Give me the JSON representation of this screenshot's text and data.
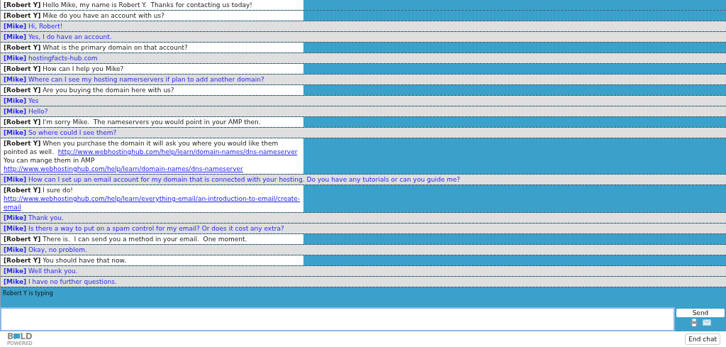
{
  "messages": [
    {
      "kind": "operator",
      "sender": "[Robert Y]",
      "segments": [
        {
          "kind": "text",
          "text": "Hello Mike, my name is Robert Y.  Thanks for contacting us today!"
        }
      ]
    },
    {
      "kind": "operator",
      "sender": "[Robert Y]",
      "segments": [
        {
          "kind": "text",
          "text": "Mike do you have an account with us?"
        }
      ]
    },
    {
      "kind": "visitor",
      "sender": "[Mike]",
      "segments": [
        {
          "kind": "text",
          "text": "Hi, Robert!"
        }
      ]
    },
    {
      "kind": "visitor",
      "sender": "[Mike]",
      "segments": [
        {
          "kind": "text",
          "text": "Yes, I do have an account."
        }
      ]
    },
    {
      "kind": "operator",
      "sender": "[Robert Y]",
      "segments": [
        {
          "kind": "text",
          "text": "What is the primary domain on that account?"
        }
      ]
    },
    {
      "kind": "visitor",
      "sender": "[Mike]",
      "segments": [
        {
          "kind": "text",
          "text": "hostingfacts-hub.com"
        }
      ]
    },
    {
      "kind": "operator",
      "sender": "[Robert Y]",
      "segments": [
        {
          "kind": "text",
          "text": "How can I help you Mike?"
        }
      ]
    },
    {
      "kind": "visitor",
      "sender": "[Mike]",
      "segments": [
        {
          "kind": "text",
          "text": "Where can I see my hosting namerservers if plan to add another domain?"
        }
      ]
    },
    {
      "kind": "operator",
      "sender": "[Robert Y]",
      "segments": [
        {
          "kind": "text",
          "text": "Are you buying the domain here with us?"
        }
      ]
    },
    {
      "kind": "visitor",
      "sender": "[Mike]",
      "segments": [
        {
          "kind": "text",
          "text": "Yes"
        }
      ]
    },
    {
      "kind": "visitor",
      "sender": "[Mike]",
      "segments": [
        {
          "kind": "text",
          "text": "Hello?"
        }
      ]
    },
    {
      "kind": "operator",
      "sender": "[Robert Y]",
      "segments": [
        {
          "kind": "text",
          "text": "I'm sorry Mike.  The nameservers you would point in your AMP then."
        }
      ]
    },
    {
      "kind": "visitor",
      "sender": "[Mike]",
      "segments": [
        {
          "kind": "text",
          "text": "So where could I see them?"
        }
      ]
    },
    {
      "kind": "operator",
      "sender": "[Robert Y]",
      "segments": [
        {
          "kind": "text",
          "text": "When you purchase the domain it will ask you where you would like them pointed as well. "
        },
        {
          "kind": "link",
          "text": "http://www.webhostinghub.com/help/learn/domain-names/dns-nameserver"
        },
        {
          "kind": "text",
          "text": " You can mange them in AMP"
        },
        {
          "kind": "link",
          "text": "http://www.webhostinghub.com/help/learn/domain-names/dns-nameserver"
        }
      ]
    },
    {
      "kind": "visitor",
      "sender": "[Mike]",
      "segments": [
        {
          "kind": "text",
          "text": "How can I set up an email account for my domain that is connected with your hosting. Do you have any tutorials or can you guide me?"
        }
      ]
    },
    {
      "kind": "operator",
      "sender": "[Robert Y]",
      "segments": [
        {
          "kind": "text",
          "text": "I sure do!"
        },
        {
          "kind": "link",
          "text": "http://www.webhostinghub.com/help/learn/everything-email/an-introduction-to-email/create-email"
        }
      ]
    },
    {
      "kind": "visitor",
      "sender": "[Mike]",
      "segments": [
        {
          "kind": "text",
          "text": "Thank you."
        }
      ]
    },
    {
      "kind": "visitor",
      "sender": "[Mike]",
      "segments": [
        {
          "kind": "text",
          "text": "Is there a way to put on a spam control for my email? Or does it cost any extra?"
        }
      ]
    },
    {
      "kind": "operator",
      "sender": "[Robert Y]",
      "segments": [
        {
          "kind": "text",
          "text": "There is.  I can send you a method in your email.  One moment."
        }
      ]
    },
    {
      "kind": "visitor",
      "sender": "[Mike]",
      "segments": [
        {
          "kind": "text",
          "text": "Okay, no problem."
        }
      ]
    },
    {
      "kind": "operator",
      "sender": "[Robert Y]",
      "segments": [
        {
          "kind": "text",
          "text": "You should have that now."
        }
      ]
    },
    {
      "kind": "visitor",
      "sender": "[Mike]",
      "segments": [
        {
          "kind": "text",
          "text": "Well thank you."
        }
      ]
    },
    {
      "kind": "visitor",
      "sender": "[Mike]",
      "segments": [
        {
          "kind": "text",
          "text": "I have no further questions."
        }
      ]
    }
  ],
  "typing_status": "Robert Y is typing",
  "send_button": "Send",
  "logo": {
    "left": "B",
    "right": "LD",
    "tagline": "POWERED"
  },
  "end_chat_button": "End chat"
}
